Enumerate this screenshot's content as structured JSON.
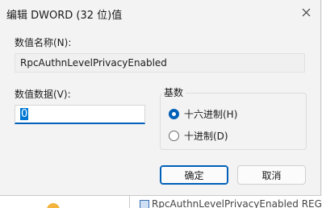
{
  "dialog": {
    "title": "编辑 DWORD (32 位)值",
    "value_name_label": "数值名称(N):",
    "value_name": "RpcAuthnLevelPrivacyEnabled",
    "value_data_label": "数值数据(V):",
    "value_data": "0",
    "base": {
      "title": "基数",
      "options": [
        "十六进制(H)",
        "十进制(D)"
      ],
      "selected": "十六进制(H)"
    },
    "ok_label": "确定",
    "cancel_label": "取消"
  },
  "background": {
    "list_item_text": "RpcAuthnLevelPrivacyEnabled  REG_DWORD"
  },
  "colors": {
    "accent": "#005fb8",
    "selection": "#0078d4"
  },
  "icons": {
    "close": "close-icon",
    "registry_value": "registry-value-icon"
  }
}
